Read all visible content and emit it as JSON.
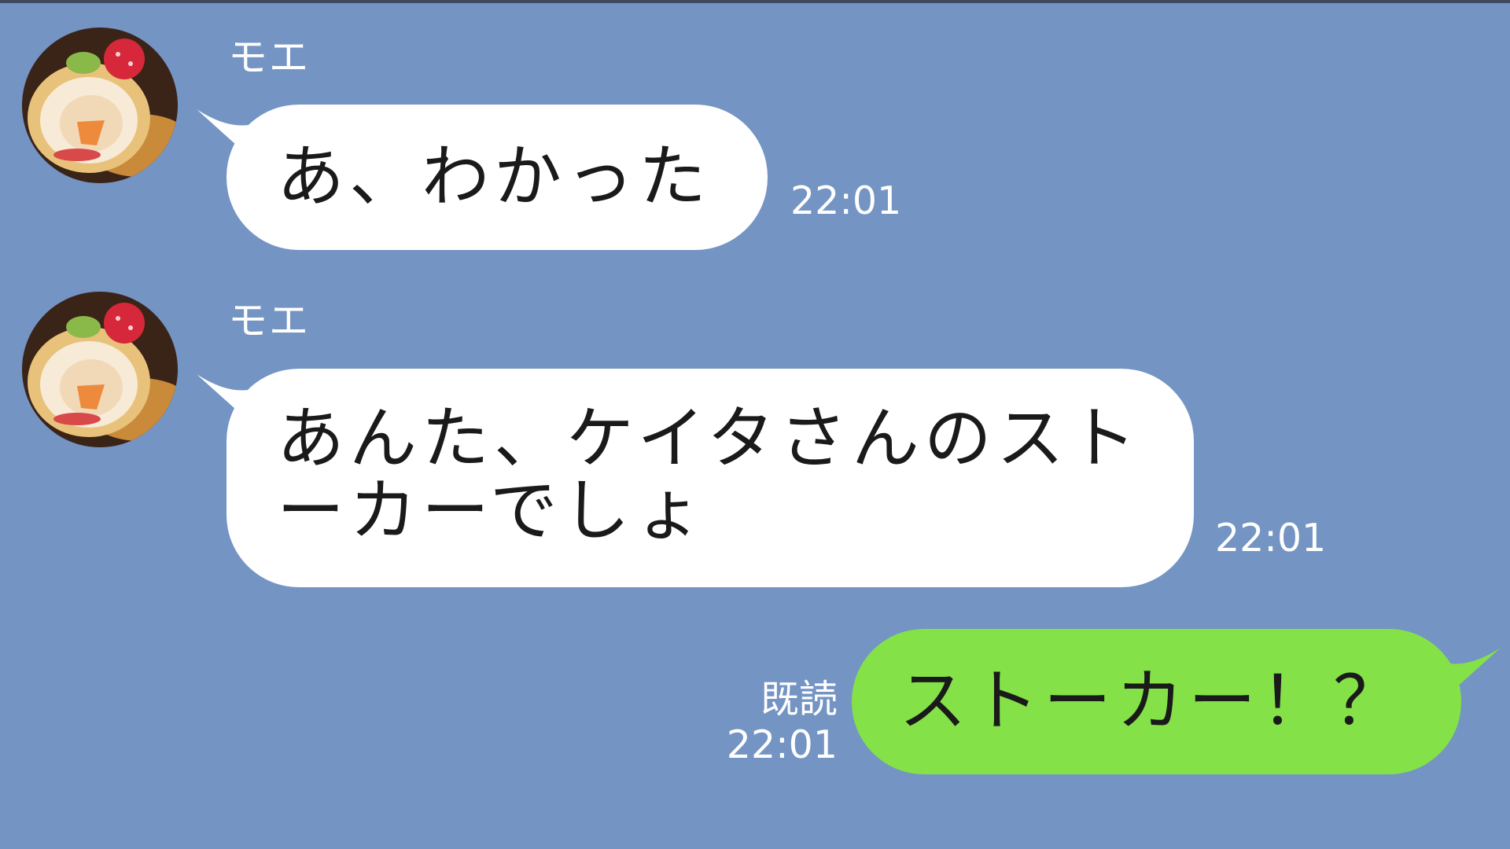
{
  "chat": {
    "messages": [
      {
        "direction": "incoming",
        "sender": "モエ",
        "avatar_icon": "roll-cake-avatar-icon",
        "text": "あ、わかった",
        "time": "22:01"
      },
      {
        "direction": "incoming",
        "sender": "モエ",
        "avatar_icon": "roll-cake-avatar-icon",
        "text": "あんた、ケイタさんのスト\nーカーでしょ",
        "time": "22:01"
      },
      {
        "direction": "outgoing",
        "text": "ストーカー！？",
        "read_label": "既読",
        "time": "22:01"
      }
    ]
  },
  "colors": {
    "background": "#7494c3",
    "incoming_bubble": "#ffffff",
    "outgoing_bubble": "#84e148",
    "meta_text": "#ffffff"
  }
}
